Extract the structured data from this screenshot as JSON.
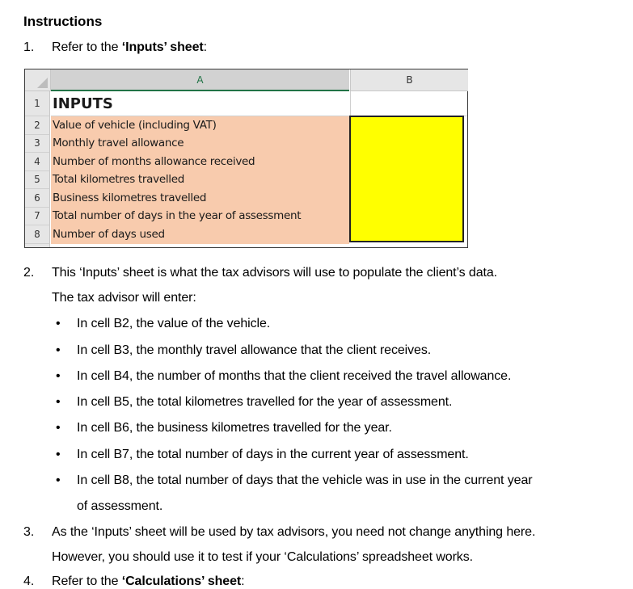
{
  "document": {
    "heading": "Instructions",
    "items": [
      {
        "number": "1.",
        "text_prefix": "Refer to the ",
        "text_bold": "‘Inputs’ sheet",
        "text_suffix": ":"
      },
      {
        "number": "2.",
        "lines": [
          "This ‘Inputs’ sheet is what the tax advisors will use to populate the client’s data.",
          "The tax advisor will enter:"
        ],
        "bullets": [
          "In cell B2, the value of the vehicle.",
          "In cell B3, the monthly travel allowance that the client receives.",
          "In cell B4, the number of months that the client received the travel allowance.",
          "In cell B5, the total kilometres travelled for the year of assessment.",
          "In cell B6, the business kilometres travelled for the year.",
          "In cell B7, the total number of days in the current year of assessment.",
          "In cell B8, the total number of days that the vehicle was in use in the current year",
          "of assessment."
        ]
      },
      {
        "number": "3.",
        "lines": [
          "As the ‘Inputs’ sheet will be used by tax advisors, you need not change anything here.",
          "However, you should use it to test if your ‘Calculations’ spreadsheet works."
        ]
      },
      {
        "number": "4.",
        "text_prefix": "Refer to the ",
        "text_bold": "‘Calculations’ sheet",
        "text_suffix": ":"
      }
    ]
  },
  "spreadsheet": {
    "columns": [
      "A",
      "B"
    ],
    "rows": [
      {
        "row": "1",
        "a": "INPUTS",
        "b": ""
      },
      {
        "row": "2",
        "a": "Value of vehicle (including VAT)",
        "b": ""
      },
      {
        "row": "3",
        "a": "Monthly travel allowance",
        "b": ""
      },
      {
        "row": "4",
        "a": "Number of months allowance received",
        "b": ""
      },
      {
        "row": "5",
        "a": "Total kilometres travelled",
        "b": ""
      },
      {
        "row": "6",
        "a": "Business kilometres travelled",
        "b": ""
      },
      {
        "row": "7",
        "a": "Total number of days in the year of assessment",
        "b": ""
      },
      {
        "row": "8",
        "a": "Number of days used",
        "b": ""
      }
    ],
    "colors": {
      "label_fill": "#f8cbad",
      "input_fill": "#ffff00",
      "selected_column_accent": "#217346"
    }
  }
}
